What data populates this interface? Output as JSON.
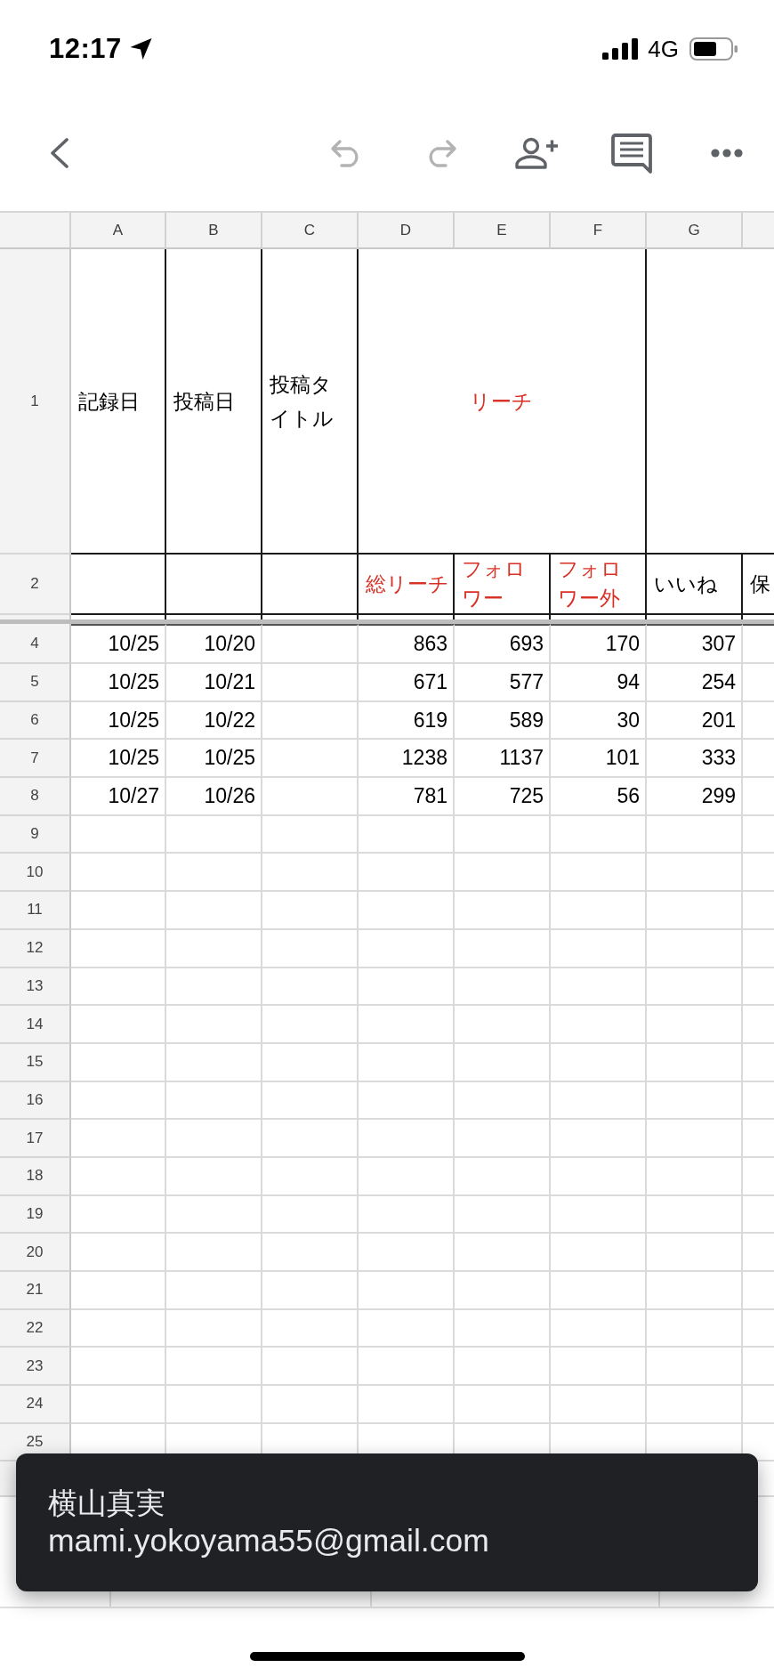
{
  "status_bar": {
    "time": "12:17",
    "network": "4G"
  },
  "toolbar": {
    "undo": {
      "disabled": true
    },
    "redo": {
      "disabled": true
    }
  },
  "sheet": {
    "columns": [
      "A",
      "B",
      "C",
      "D",
      "E",
      "F",
      "G"
    ],
    "header_row_numbers": [
      "1",
      "2"
    ],
    "header": [
      {
        "text": "記録日",
        "color": "#000000"
      },
      {
        "text": "投稿日",
        "color": "#000000"
      },
      {
        "text": "投稿タイトル",
        "color": "#000000"
      },
      {
        "text": "リーチ",
        "color": "#d93025",
        "children": [
          {
            "text": "総リーチ",
            "color": "#d93025"
          },
          {
            "text": "フォロワー",
            "color": "#d93025"
          },
          {
            "text": "フォロワー外",
            "color": "#d93025"
          }
        ]
      },
      {
        "children": [
          {
            "text": "いいね",
            "color": "#000000"
          },
          {
            "text": "保",
            "color": "#000000"
          }
        ]
      }
    ],
    "rows": [
      {
        "number": "4",
        "cells": [
          {
            "value": "10/25"
          },
          {
            "value": "10/20"
          },
          {},
          {
            "value": "863"
          },
          {
            "value": "693"
          },
          {
            "value": "170"
          },
          {
            "value": "307"
          }
        ]
      },
      {
        "number": "5",
        "cells": [
          {
            "value": "10/25"
          },
          {
            "value": "10/21"
          },
          {},
          {
            "value": "671"
          },
          {
            "value": "577"
          },
          {
            "value": "94"
          },
          {
            "value": "254"
          }
        ]
      },
      {
        "number": "6",
        "cells": [
          {
            "value": "10/25"
          },
          {
            "value": "10/22"
          },
          {},
          {
            "value": "619"
          },
          {
            "value": "589"
          },
          {
            "value": "30"
          },
          {
            "value": "201"
          }
        ]
      },
      {
        "number": "7",
        "cells": [
          {
            "value": "10/25"
          },
          {
            "value": "10/25"
          },
          {},
          {
            "value": "1238"
          },
          {
            "value": "1137"
          },
          {
            "value": "101"
          },
          {
            "value": "333"
          }
        ]
      },
      {
        "number": "8",
        "cells": [
          {
            "value": "10/27"
          },
          {
            "value": "10/26"
          },
          {},
          {
            "value": "781"
          },
          {
            "value": "725"
          },
          {
            "value": "56"
          },
          {
            "value": "299"
          }
        ]
      },
      {
        "number": "9"
      },
      {
        "number": "10"
      },
      {
        "number": "11"
      },
      {
        "number": "12"
      },
      {
        "number": "13"
      },
      {
        "number": "14"
      },
      {
        "number": "15"
      },
      {
        "number": "16"
      },
      {
        "number": "17"
      },
      {
        "number": "18"
      },
      {
        "number": "19"
      },
      {
        "number": "20"
      },
      {
        "number": "21"
      },
      {
        "number": "22"
      },
      {
        "number": "23"
      },
      {
        "number": "24"
      },
      {
        "number": "25"
      }
    ]
  },
  "toast": {
    "name": "横山真実",
    "email": "mami.yokoyama55@gmail.com"
  }
}
